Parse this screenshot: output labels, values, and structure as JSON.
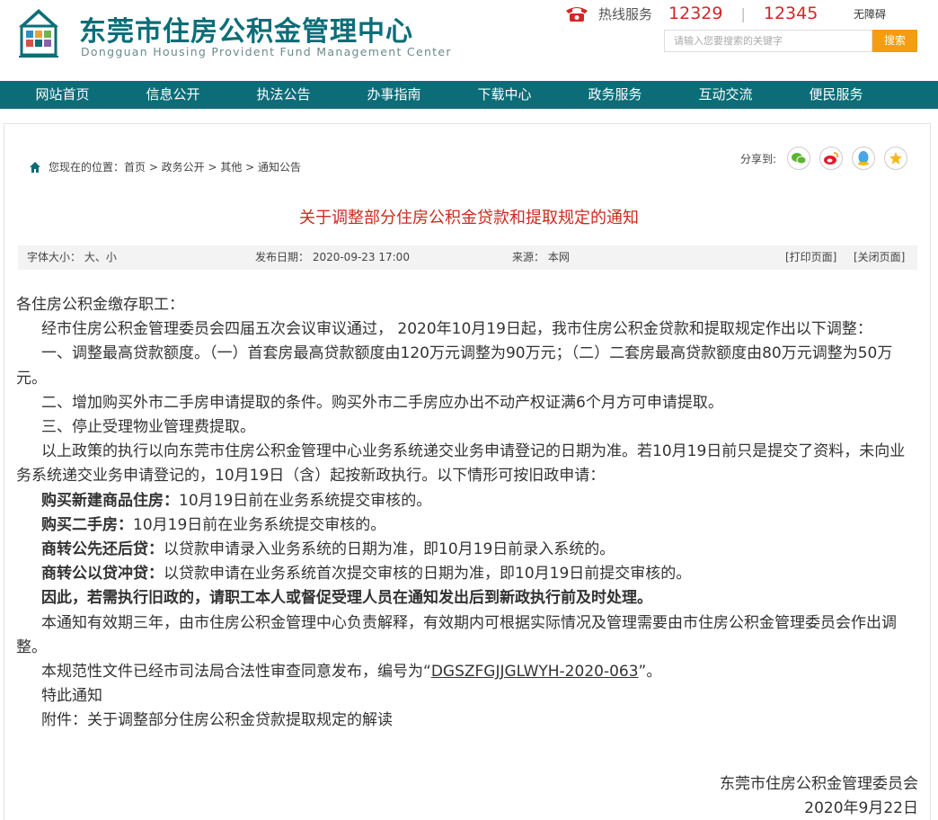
{
  "header": {
    "title": "东莞市住房公积金管理中心",
    "subtitle": "Dongguan Housing Provident Fund Management Center",
    "hotline_label": "热线服务",
    "hotline_1": "12329",
    "hotline_2": "12345",
    "accessible": "无障碍",
    "search_placeholder": "请输入您要搜索的关键字",
    "search_button": "搜索"
  },
  "nav": [
    "网站首页",
    "信息公开",
    "执法公告",
    "办事指南",
    "下载中心",
    "政务服务",
    "互动交流",
    "便民服务"
  ],
  "breadcrumb": "您现在的位置：首页 > 政务公开 > 其他 > 通知公告",
  "share_label": "分享到:",
  "share_icons": [
    "wechat-icon",
    "weibo-icon",
    "qq-icon",
    "favorite-icon"
  ],
  "article": {
    "title": "关于调整部分住房公积金贷款和提取规定的通知",
    "meta": {
      "font_size": "字体大小：  大、小",
      "date": "发布日期：  2020-09-23 17:00",
      "source": "来源：  本网",
      "print": "[打印页面]",
      "close": "[关闭页面]"
    },
    "salutation": "各住房公积金缴存职工：",
    "p1": "经市住房公积金管理委员会四届五次会议审议通过， 2020年10月19日起，我市住房公积金贷款和提取规定作出以下调整：",
    "p2": "一、调整最高贷款额度。（一）首套房最高贷款额度由120万元调整为90万元；（二）二套房最高贷款额度由80万元调整为50万元。",
    "p3": "二、增加购买外市二手房申请提取的条件。购买外市二手房应办出不动产权证满6个月方可申请提取。",
    "p4": "三、停止受理物业管理费提取。",
    "p5": "以上政策的执行以向东莞市住房公积金管理中心业务系统递交业务申请登记的日期为准。若10月19日前只是提交了资料，未向业务系统递交业务申请登记的，10月19日（含）起按新政执行。以下情形可按旧政申请：",
    "item1_label": "购买新建商品住房：",
    "item1_text": "10月19日前在业务系统提交审核的。",
    "item2_label": "购买二手房：",
    "item2_text": "10月19日前在业务系统提交审核的。",
    "item3_label": "商转公先还后贷：",
    "item3_text": "以贷款申请录入业务系统的日期为准，即10月19日前录入系统的。",
    "item4_label": "商转公以贷冲贷：",
    "item4_text": "以贷款申请在业务系统首次提交审核的日期为准，即10月19日前提交审核的。",
    "bold_note": "因此，若需执行旧政的，请职工本人或督促受理人员在通知发出后到新政执行前及时处理。",
    "p6": "本通知有效期三年，由市住房公积金管理中心负责解释，有效期内可根据实际情况及管理需要由市住房公积金管理委员会作出调整。",
    "p7_prefix": "本规范性文件已经市司法局合法性审查同意发布，编号为“",
    "p7_code": "DGSZFGJJGLWYH-2020-063",
    "p7_suffix": "”。",
    "p8": "特此通知",
    "p9": "附件：关于调整部分住房公积金贷款提取规定的解读",
    "signature": "东莞市住房公积金管理委员会",
    "sign_date": "2020年9月22日"
  }
}
